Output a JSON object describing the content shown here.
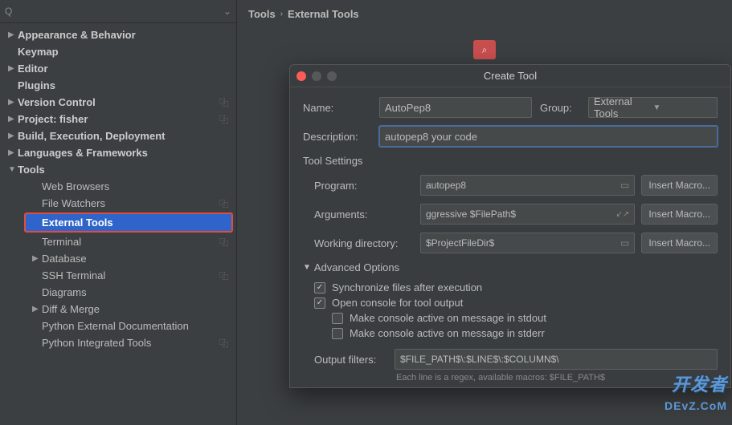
{
  "search": {
    "placeholder": ""
  },
  "sidebar": {
    "items": [
      {
        "label": "Appearance & Behavior",
        "expanded": false,
        "top": true
      },
      {
        "label": "Keymap",
        "top": true,
        "noarrow": true
      },
      {
        "label": "Editor",
        "expanded": false,
        "top": true
      },
      {
        "label": "Plugins",
        "top": true,
        "noarrow": true
      },
      {
        "label": "Version Control",
        "expanded": false,
        "top": true,
        "copy": true
      },
      {
        "label": "Project: fisher",
        "expanded": false,
        "top": true,
        "copy": true
      },
      {
        "label": "Build, Execution, Deployment",
        "expanded": false,
        "top": true
      },
      {
        "label": "Languages & Frameworks",
        "expanded": false,
        "top": true
      },
      {
        "label": "Tools",
        "expanded": true,
        "top": true
      },
      {
        "label": "Web Browsers",
        "child": true
      },
      {
        "label": "File Watchers",
        "child": true,
        "copy": true
      },
      {
        "label": "External Tools",
        "child": true,
        "selected": true,
        "highlighted": true
      },
      {
        "label": "Terminal",
        "child": true,
        "copy": true
      },
      {
        "label": "Database",
        "child": true,
        "arrow": true
      },
      {
        "label": "SSH Terminal",
        "child": true,
        "copy": true
      },
      {
        "label": "Diagrams",
        "child": true
      },
      {
        "label": "Diff & Merge",
        "child": true,
        "arrow": true
      },
      {
        "label": "Python External Documentation",
        "child": true
      },
      {
        "label": "Python Integrated Tools",
        "child": true,
        "copy": true
      }
    ]
  },
  "breadcrumb": {
    "root": "Tools",
    "page": "External Tools"
  },
  "dialog": {
    "title": "Create Tool",
    "name_label": "Name:",
    "name_value": "AutoPep8",
    "group_label": "Group:",
    "group_value": "External Tools",
    "desc_label": "Description:",
    "desc_value": "autopep8 your code",
    "toolsettings_label": "Tool Settings",
    "program_label": "Program:",
    "program_value": "autopep8",
    "arguments_label": "Arguments:",
    "arguments_value": "ggressive $FilePath$",
    "wd_label": "Working directory:",
    "wd_value": "$ProjectFileDir$",
    "insert_macro": "Insert Macro...",
    "adv_label": "Advanced Options",
    "chk_sync": "Synchronize files after execution",
    "chk_console": "Open console for tool output",
    "chk_stdout": "Make console active on message in stdout",
    "chk_stderr": "Make console active on message in stderr",
    "out_filters_label": "Output filters:",
    "out_filters_value": "$FILE_PATH$\\:$LINE$\\:$COLUMN$\\",
    "hint": "Each line is a regex, available macros: $FILE_PATH$"
  },
  "watermark": {
    "line1": "开发者",
    "line2": "DEvZ.CoM"
  }
}
